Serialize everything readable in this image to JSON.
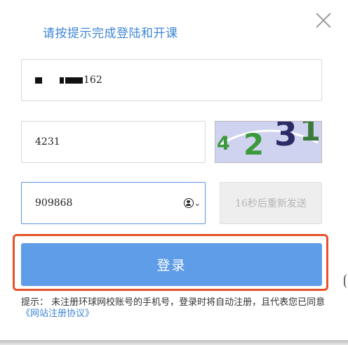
{
  "dialog": {
    "title": "请按提示完成登陆和开课"
  },
  "phone": {
    "visible_suffix": "162"
  },
  "captcha": {
    "input_value": "4231",
    "image_digits": [
      {
        "char": "4",
        "color": "#3a9a3a"
      },
      {
        "char": "2",
        "color": "#3c9a3c"
      },
      {
        "char": "3",
        "color": "#2b2b66"
      },
      {
        "char": "1",
        "color": "#3a7a3a"
      }
    ]
  },
  "sms": {
    "code_value": "909868",
    "resend_label": "16秒后重新发送"
  },
  "login": {
    "button_label": "登录"
  },
  "tip": {
    "text": "提示： 未注册环球网校账号的手机号，登录时将自动注册，且代表您已同意",
    "agreement_link": "《网站注册协议》"
  },
  "colors": {
    "title_blue": "#3f86d4",
    "button_blue": "#5f9de8",
    "highlight_orange": "#e6512a"
  }
}
